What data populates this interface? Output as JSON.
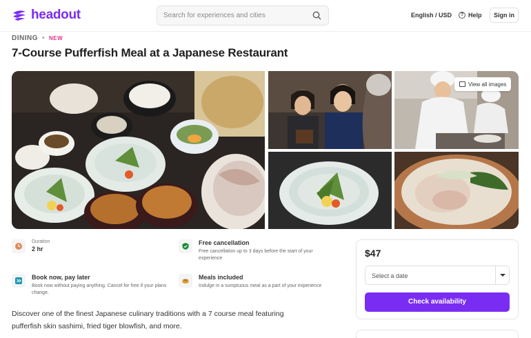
{
  "header": {
    "brand": "headout",
    "search_placeholder": "Search for experiences and cities",
    "language": "English / USD",
    "help": "Help",
    "sign_in": "Sign in"
  },
  "breadcrumb": {
    "category": "DINING",
    "separator": "•",
    "badge": "NEW"
  },
  "page": {
    "title": "7-Course Pufferfish Meal at a Japanese Restaurant"
  },
  "gallery": {
    "view_all": "View all images"
  },
  "features": {
    "duration": {
      "label": "Duration",
      "value": "2 hr",
      "icon": "clock-icon"
    },
    "cancellation": {
      "title": "Free cancellation",
      "desc": "Free cancellation up to 3 days before the start of your experience",
      "icon": "shield-check-icon"
    },
    "book_now": {
      "title": "Book now, pay later",
      "desc": "Book now without paying anything. Cancel for free if your plans change.",
      "icon": "pay-later-icon"
    },
    "meals": {
      "title": "Meals included",
      "desc": "Indulge in a sumptuous meal as a part of your experience",
      "icon": "meal-bowl-icon"
    }
  },
  "description": "Discover one of the finest Japanese culinary traditions with a 7 course meal featuring pufferfish skin sashimi, fried tiger blowfish, and more.",
  "booking": {
    "price": "$47",
    "date_placeholder": "Select a date",
    "cta": "Check availability"
  },
  "colors": {
    "brand": "#7a2df2",
    "badge": "#e2348c"
  }
}
